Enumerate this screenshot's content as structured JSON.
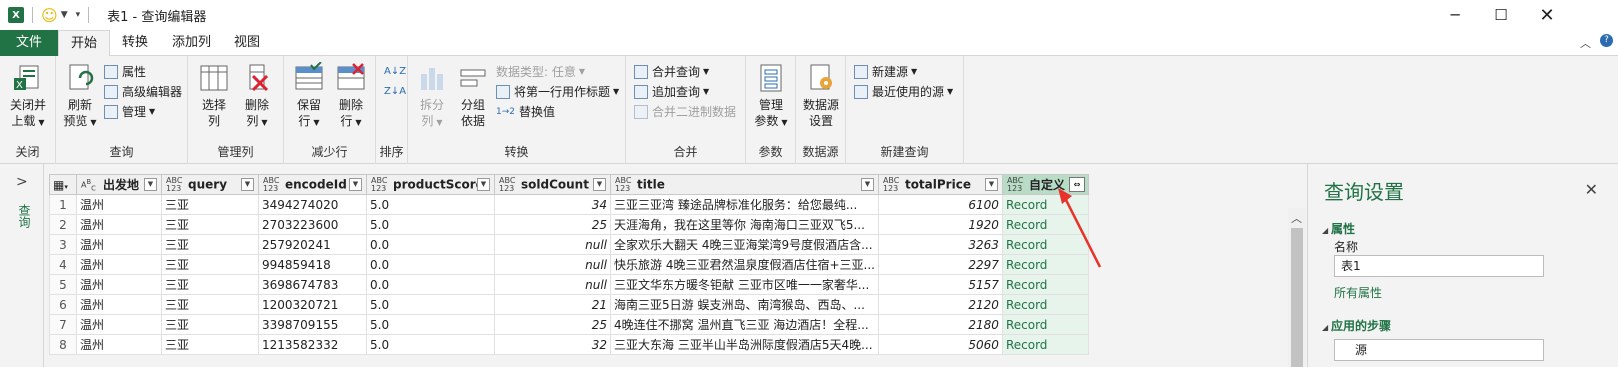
{
  "window": {
    "title": "表1 - 查询编辑器",
    "app_icon": "excel-icon"
  },
  "tabs": [
    {
      "label": "文件"
    },
    {
      "label": "开始"
    },
    {
      "label": "转换"
    },
    {
      "label": "添加列"
    },
    {
      "label": "视图"
    }
  ],
  "ribbon": {
    "close": {
      "group": "关闭",
      "btn_l1": "关闭并",
      "btn_l2": "上载"
    },
    "query": {
      "group": "查询",
      "refresh_l1": "刷新",
      "refresh_l2": "预览",
      "properties": "属性",
      "adv_editor": "高级编辑器",
      "manage": "管理"
    },
    "manage_cols": {
      "group": "管理列",
      "choose_l1": "选择",
      "choose_l2": "列",
      "remove_l1": "删除",
      "remove_l2": "列"
    },
    "reduce_rows": {
      "group": "减少行",
      "keep_l1": "保留",
      "keep_l2": "行",
      "remove_l1": "删除",
      "remove_l2": "行"
    },
    "sort": {
      "group": "排序"
    },
    "transform": {
      "group": "转换",
      "split_l1": "拆分",
      "split_l2": "列",
      "groupby_l1": "分组",
      "groupby_l2": "依据",
      "datatype": "数据类型: 任意",
      "first_row": "将第一行用作标题",
      "replace": "替换值"
    },
    "combine": {
      "group": "合并",
      "merge": "合并查询",
      "append": "追加查询",
      "merge_binary": "合并二进制数据"
    },
    "params": {
      "group": "参数",
      "manage_l1": "管理",
      "manage_l2": "参数"
    },
    "datasource": {
      "group": "数据源",
      "settings_l1": "数据源",
      "settings_l2": "设置"
    },
    "newquery": {
      "group": "新建查询",
      "new_source": "新建源",
      "recent": "最近使用的源"
    }
  },
  "nav": {
    "label": "查询"
  },
  "grid": {
    "columns": [
      {
        "type": "ABC",
        "name": "出发地"
      },
      {
        "type": "ABC\n123",
        "name": "query"
      },
      {
        "type": "ABC\n123",
        "name": "encodeId"
      },
      {
        "type": "ABC\n123",
        "name": "productScore"
      },
      {
        "type": "ABC\n123",
        "name": "soldCount"
      },
      {
        "type": "ABC\n123",
        "name": "title"
      },
      {
        "type": "ABC\n123",
        "name": "totalPrice"
      },
      {
        "type": "ABC\n123",
        "name": "自定义"
      }
    ],
    "rows": [
      {
        "n": "1",
        "c": [
          "温州",
          "三亚",
          "3494274020",
          "5.0",
          "34",
          "三亚三亚湾 臻途品牌标准化服务：给您最纯...",
          "6100",
          "Record"
        ]
      },
      {
        "n": "2",
        "c": [
          "温州",
          "三亚",
          "2703223600",
          "5.0",
          "25",
          "天涯海角，我在这里等你 海南海口三亚双飞5...",
          "1920",
          "Record"
        ]
      },
      {
        "n": "3",
        "c": [
          "温州",
          "三亚",
          "257920241",
          "0.0",
          "null",
          "全家欢乐大翻天 4晚三亚海棠湾9号度假酒店含...",
          "3263",
          "Record"
        ]
      },
      {
        "n": "4",
        "c": [
          "温州",
          "三亚",
          "994859418",
          "0.0",
          "null",
          "快乐旅游 4晚三亚君然温泉度假酒店住宿+三亚...",
          "2297",
          "Record"
        ]
      },
      {
        "n": "5",
        "c": [
          "温州",
          "三亚",
          "3698674783",
          "0.0",
          "null",
          "三亚文华东方暖冬钜献 三亚市区唯一一家奢华...",
          "5157",
          "Record"
        ]
      },
      {
        "n": "6",
        "c": [
          "温州",
          "三亚",
          "1200320721",
          "5.0",
          "21",
          "海南三亚5日游 蜈支洲岛、南湾猴岛、西岛、...",
          "2120",
          "Record"
        ]
      },
      {
        "n": "7",
        "c": [
          "温州",
          "三亚",
          "3398709155",
          "5.0",
          "25",
          "4晚连住不挪窝 温州直飞三亚 海边酒店！全程...",
          "2180",
          "Record"
        ]
      },
      {
        "n": "8",
        "c": [
          "温州",
          "三亚",
          "1213582332",
          "5.0",
          "32",
          "三亚大东海 三亚半山半岛洲际度假酒店5天4晚...",
          "5060",
          "Record"
        ]
      }
    ]
  },
  "settings": {
    "title": "查询设置",
    "properties_header": "属性",
    "name_label": "名称",
    "name_value": "表1",
    "all_props_link": "所有属性",
    "steps_header": "应用的步骤",
    "steps": [
      "源"
    ]
  },
  "colors": {
    "brand": "#217346",
    "custom_col": "#b9dcc6",
    "annotation": "#e8332a"
  }
}
